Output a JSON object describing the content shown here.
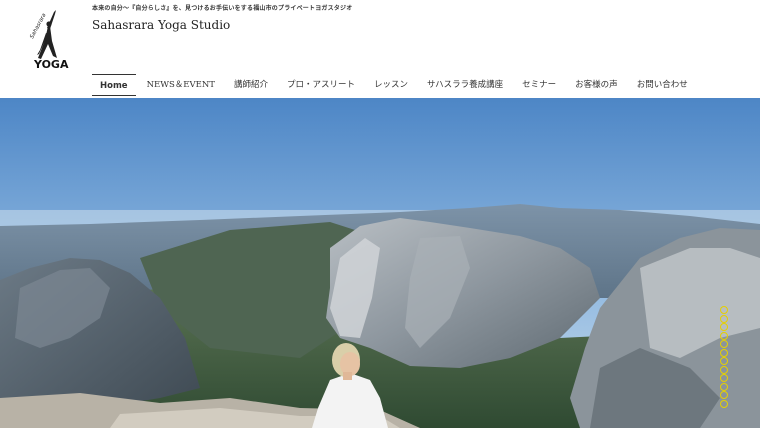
{
  "header": {
    "tagline": "本来の自分～『自分らしさ』を、見つけるお手伝いをする福山市のプライベートヨガスタジオ",
    "site_title": "Sahasrara Yoga Studio",
    "logo": {
      "arc_text": "Sahasrara",
      "word": "YOGA"
    }
  },
  "nav": {
    "items": [
      {
        "label": "Home",
        "active": true
      },
      {
        "label": "NEWS＆EVENT"
      },
      {
        "label": "講師紹介"
      },
      {
        "label": "プロ・アスリート"
      },
      {
        "label": "レッスン"
      },
      {
        "label": "サハスララ養成講座"
      },
      {
        "label": "セミナー"
      },
      {
        "label": "お客様の声"
      },
      {
        "label": "お問い合わせ"
      }
    ]
  },
  "hero": {
    "dot_color": "#e5d000",
    "slide_count": 12
  }
}
